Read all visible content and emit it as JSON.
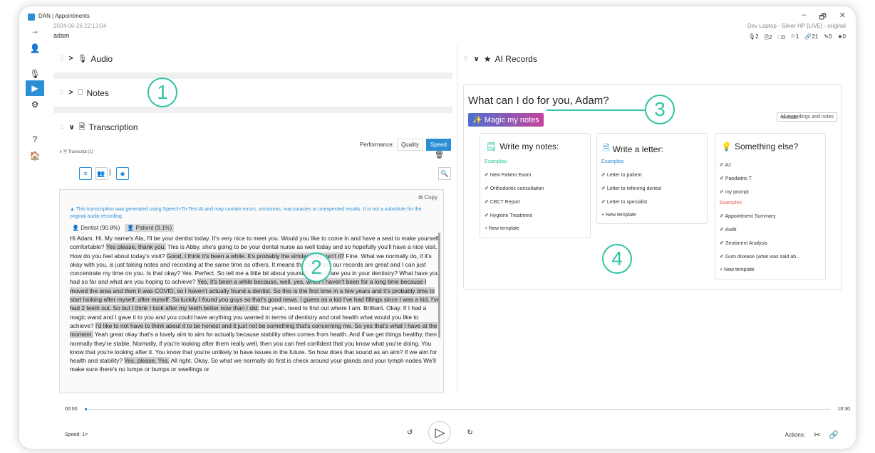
{
  "window": {
    "title": "DAN | Appointments",
    "controls": {
      "minimize": "–",
      "restore": "🗗",
      "close": "✕"
    },
    "device": "Dev Laptop - Silver HP [LIVE] - original",
    "counts": [
      {
        "icon": "🎙",
        "value": "2"
      },
      {
        "icon": "🗎",
        "value": "2"
      },
      {
        "icon": "🗆",
        "value": "0"
      },
      {
        "icon": "⚐",
        "value": "1"
      },
      {
        "icon": "🔗",
        "value": "21"
      },
      {
        "icon": "✎",
        "value": "0"
      },
      {
        "icon": "★",
        "value": "0"
      }
    ]
  },
  "meta": {
    "date": "2024-06-26 22:13:04",
    "user": "adam"
  },
  "sidebar": {
    "items": [
      {
        "icon": "→",
        "name": "arrow-right-icon"
      },
      {
        "icon": "👤",
        "name": "person-icon"
      },
      {
        "icon": "🎙",
        "name": "microphone-icon"
      },
      {
        "icon": "▶",
        "name": "play-icon"
      },
      {
        "icon": "⚙",
        "name": "gears-icon"
      },
      {
        "icon": "?",
        "name": "help-icon"
      },
      {
        "icon": "🏠",
        "name": "home-icon"
      }
    ]
  },
  "left": {
    "audio": {
      "chevron": ">",
      "icon": "🎙",
      "label": "Audio"
    },
    "notes": {
      "chevron": ">",
      "icon": "🗆",
      "label": "Notes"
    },
    "transcription": {
      "chevron": "∨",
      "icon": "🗎",
      "label": "Transcription"
    },
    "performance": {
      "label": "Performance:",
      "quality": "Quality",
      "speed": "Speed"
    },
    "transcript_tab": "∨  🗎 Transcript (1)",
    "trash": "🗑",
    "tool_icons": {
      "list": "≡",
      "people": "👥",
      "sep": "|",
      "tag": "◆",
      "search": "🔍"
    },
    "copy": "Copy",
    "disclaimer": "This transcription was generated using Speech-To-Text AI and may contain errors, omissions, inaccuracies or unexpected results. It is not a substitute for the original audio recording.",
    "speakers": {
      "dentist": "Dentist (90.8%)",
      "patient": "Patient (9.1%)"
    },
    "transcript": [
      {
        "t": "Hi Adam. Hi. My name's Ala, I'll be your dentist today. It's very nice to meet you. Would you like to come in and have a seat to make yourself comfortable? ",
        "h": false
      },
      {
        "t": "Yes please, thank you.",
        "h": true
      },
      {
        "t": " This is Abby, she's going to be your dental nurse as well today and so hopefully you'll have a nice visit. How do you feel about today's visit? ",
        "h": false
      },
      {
        "t": "Good, I think it's been a while. It's probably the similar story, isn't it?",
        "h": true
      },
      {
        "t": " Fine. What we normally do, if it's okay with you, is just taking notes and recording at the same time as others. It means that we know our records are great and I can just concentrate my time on you. Is that okay? Yes. Perfect. So tell me a little bit about yourself. Where are you in your dentistry? What have you had so far and what are you hoping to achieve? ",
        "h": false
      },
      {
        "t": "Yes, it's been a while because, well, yes, when I haven't been for a long time because I moved the area and then it was COVID, so I haven't actually found a dentist. So this is the first time in a few years and it's probably time to start looking after myself. after myself. So luckily I found you guys so that's good news. I guess as a kid I've had fillings since I was a kid. I've had 2 teeth out. So but I think I look after my teeth better now than I did.",
        "h": true
      },
      {
        "t": " But yeah, need to find out where I am. Brilliant. Okay. If I had a magic wand and I gave it to you and you could have anything you wanted in terms of dentistry and oral health what would you like to achieve? ",
        "h": false
      },
      {
        "t": "I'd like to not have to think about it to be honest and it just not be something that's concerning me. So yes that's what I have at the moment.",
        "h": true
      },
      {
        "t": " Yeah great okay that's a lovely aim to aim for actually because stability often comes from health. And if we get things healthy, then normally they're stable. Normally, if you're looking after them really well, then you can feel confident that you know what you're doing. You know that you're looking after it. You know that you're unlikely to have issues in the future. So how does that sound as an aim? If we aim for health and stability? ",
        "h": false
      },
      {
        "t": "Yes, please. Yes.",
        "h": true
      },
      {
        "t": " All right. Okay. So what we normally do first is check around your glands and your lymph nodes We'll make sure there's no lumps or bumps or swellings or",
        "h": false
      }
    ]
  },
  "right": {
    "header": {
      "chevron": "∨",
      "icon": "★",
      "label": "AI Records"
    },
    "greeting": "What can I do for you, Adam?",
    "magic": "Magic my notes",
    "include_label": "Include:",
    "include_value": "All recordings and notes",
    "cards": [
      {
        "title": "Write my notes:",
        "icon": "🗒",
        "examples_label": "Examples:",
        "items": [
          "New Patient Exam",
          "Orthodontic consultation",
          "CBCT Report",
          "Hygiene Treatment"
        ],
        "new": "+ New template"
      },
      {
        "title": "Write a letter:",
        "icon": "🗎",
        "examples_label": "Examples:",
        "items": [
          "Letter to patient",
          "Letter to referring dentist",
          "Letter to specialist"
        ],
        "new": "+ New template"
      },
      {
        "title": "Something else?",
        "icon": "💡",
        "top_items": [
          "AJ",
          "Paediatric T",
          "my prompt"
        ],
        "examples_label": "Examples:",
        "items": [
          "Appointment Summary",
          "Audit",
          "Sentiment Analysis",
          "Gum disease (what was said ab..."
        ],
        "new": "+ New template"
      }
    ],
    "item_prefix": "✐ "
  },
  "player": {
    "start": "00:00",
    "end": "10:30",
    "progress": 0.003,
    "speed": "Speed:  1×",
    "rewind": "↺",
    "play": "▷",
    "forward": "↻",
    "actions": "Actions:",
    "tools_icon": "✂",
    "link_icon": "🔗"
  },
  "callouts": [
    "1",
    "2",
    "3",
    "4"
  ],
  "colors": {
    "accent": "#2b8fd6",
    "callout": "#2fc4a4",
    "magic_start": "#4d6fd0",
    "magic_end": "#c4449c"
  }
}
